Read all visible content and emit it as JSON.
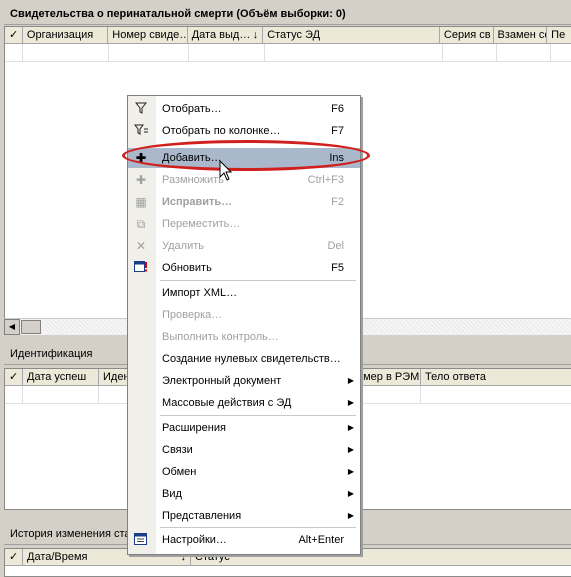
{
  "top_panel": {
    "title": "Свидетельства о перинатальной смерти (Объём выборки: 0)",
    "columns": [
      "Организация",
      "Номер свиде…",
      "Дата выд…",
      "Статус ЭД",
      "Серия св",
      "Взамен се",
      "Пе"
    ]
  },
  "ident_panel": {
    "title": "Идентификация",
    "columns": [
      "Дата успеш",
      "Иден",
      "омер в РЭМ",
      "Тело ответа"
    ]
  },
  "history_panel": {
    "title": "История изменения ста",
    "columns": [
      "Дата/Время",
      "Статус"
    ]
  },
  "context_menu": {
    "items": [
      {
        "label": "Отобрать…",
        "shortcut": "F6",
        "icon": "filter-icon"
      },
      {
        "label": "Отобрать по колонке…",
        "shortcut": "F7",
        "icon": "filter-column-icon"
      },
      {
        "label": "Добавить…",
        "shortcut": "Ins",
        "icon": "add-icon"
      },
      {
        "label": "Размножить",
        "shortcut": "Ctrl+F3",
        "icon": "duplicate-icon"
      },
      {
        "label": "Исправить…",
        "shortcut": "F2",
        "icon": "edit-icon"
      },
      {
        "label": "Переместить…",
        "shortcut": "",
        "icon": "move-icon"
      },
      {
        "label": "Удалить",
        "shortcut": "Del",
        "icon": "delete-icon"
      },
      {
        "label": "Обновить",
        "shortcut": "F5",
        "icon": "refresh-icon"
      },
      {
        "label": "Импорт XML…",
        "shortcut": ""
      },
      {
        "label": "Проверка…",
        "shortcut": ""
      },
      {
        "label": "Выполнить контроль…",
        "shortcut": ""
      },
      {
        "label": "Создание нулевых свидетельств…",
        "shortcut": ""
      },
      {
        "label": "Электронный документ",
        "shortcut": ""
      },
      {
        "label": "Массовые действия с ЭД",
        "shortcut": ""
      },
      {
        "label": "Расширения",
        "shortcut": ""
      },
      {
        "label": "Связи",
        "shortcut": ""
      },
      {
        "label": "Обмен",
        "shortcut": ""
      },
      {
        "label": "Вид",
        "shortcut": ""
      },
      {
        "label": "Представления",
        "shortcut": ""
      },
      {
        "label": "Настройки…",
        "shortcut": "Alt+Enter",
        "icon": "settings-icon"
      }
    ]
  },
  "colors": {
    "highlight": "#aab8cc",
    "ellipse": "#d0201e"
  }
}
